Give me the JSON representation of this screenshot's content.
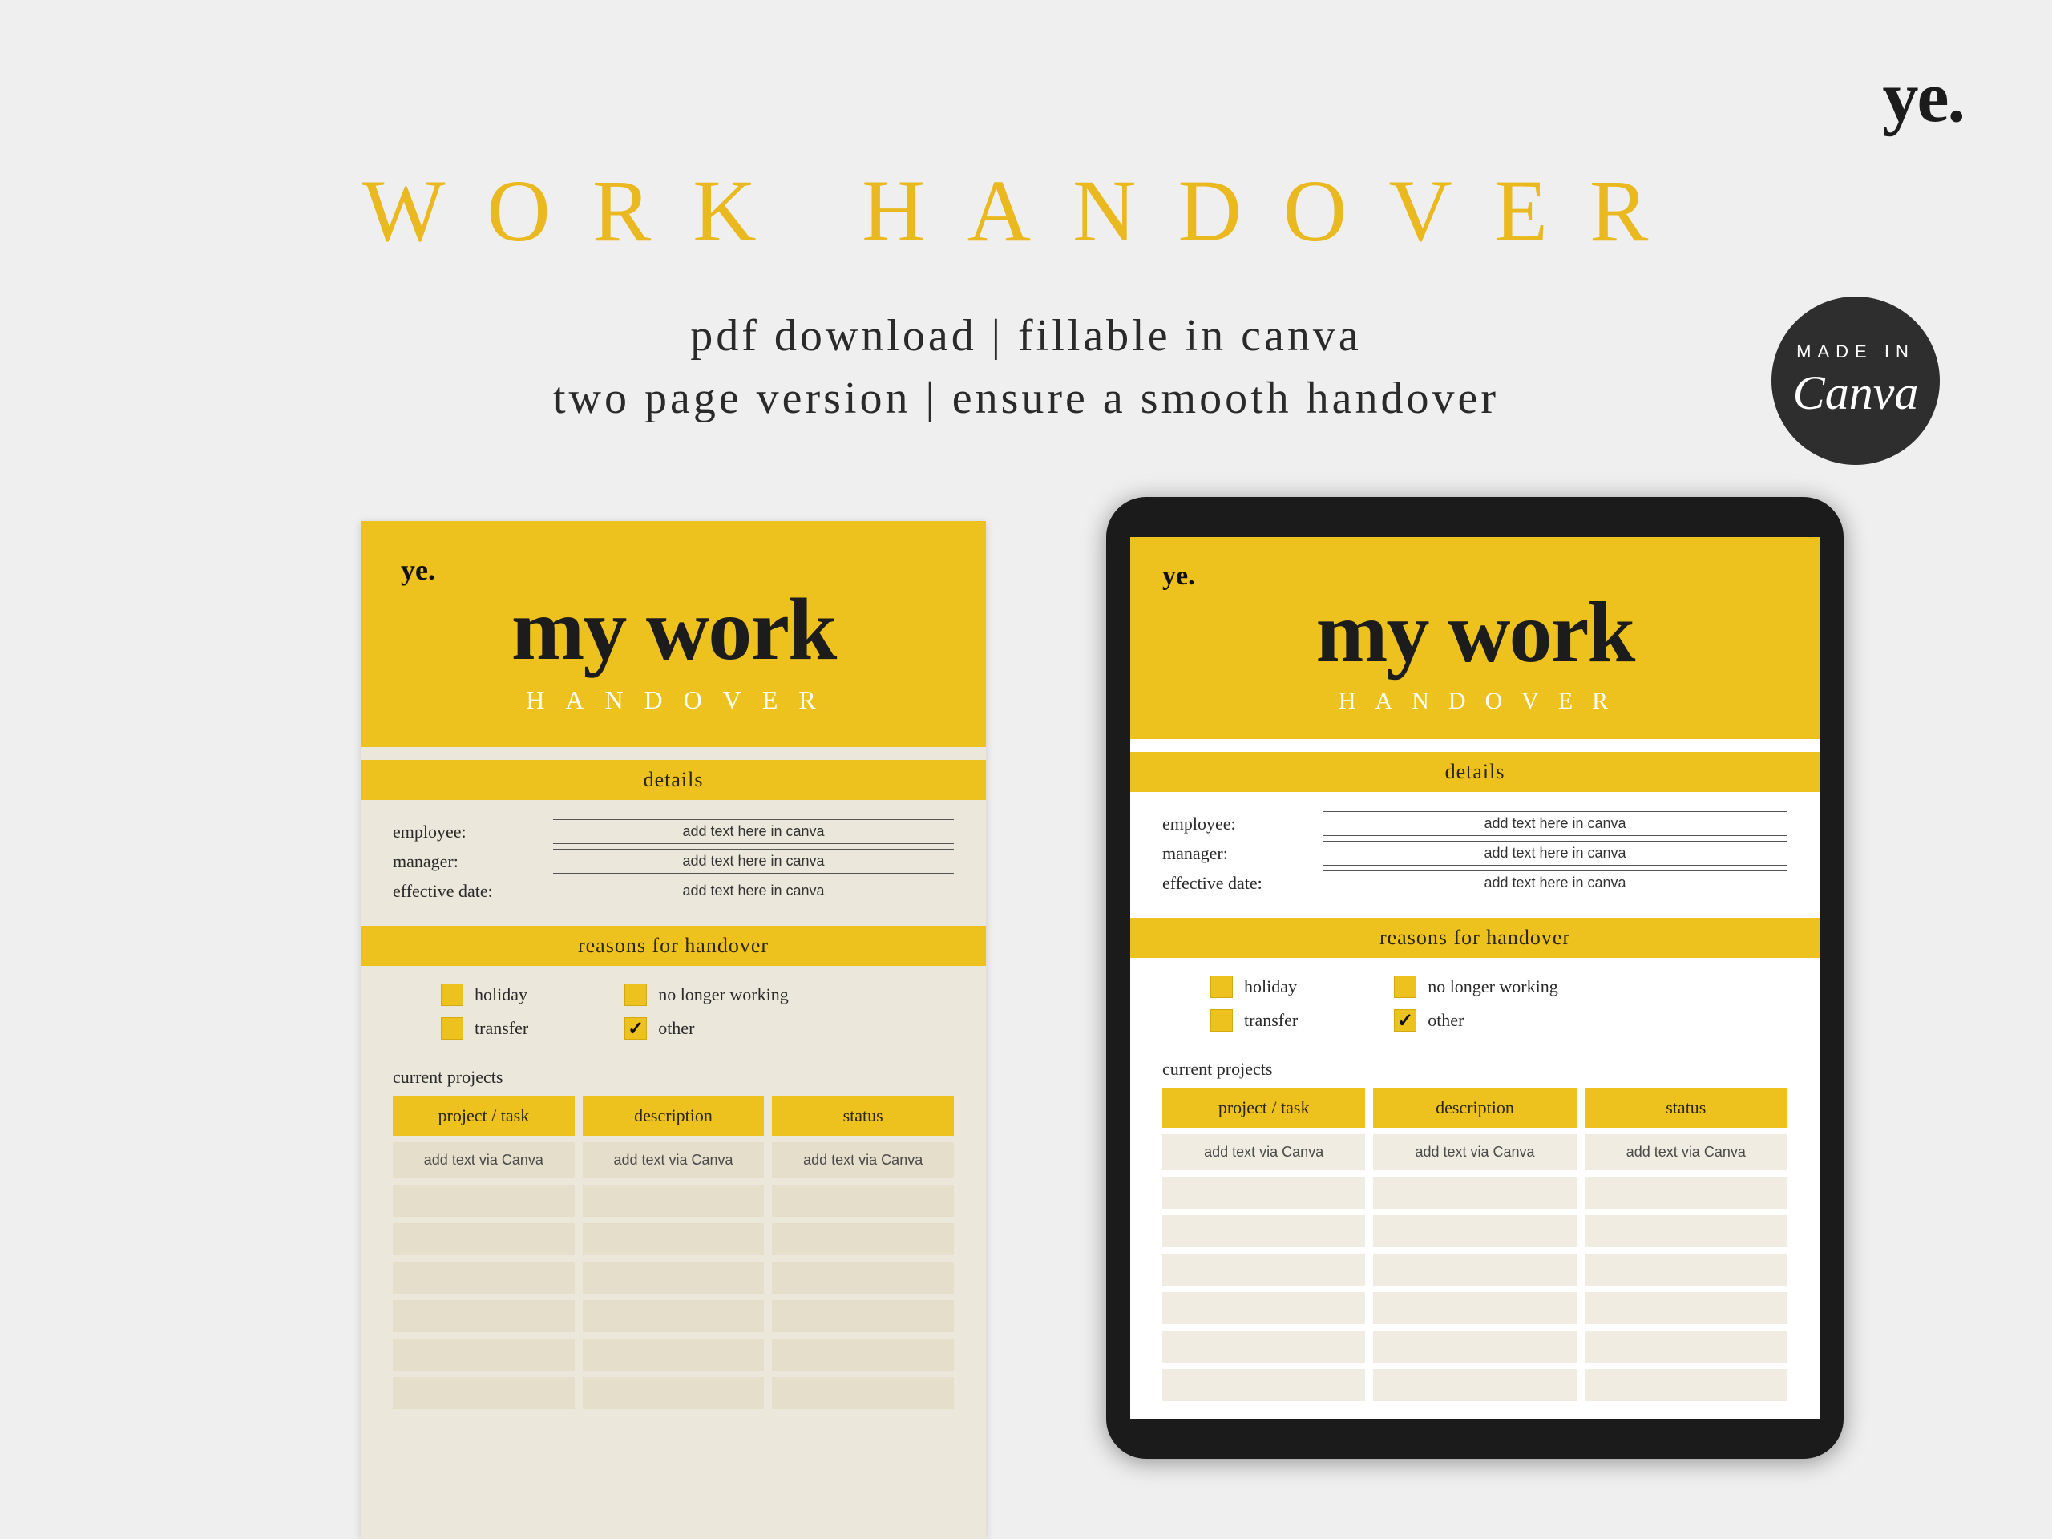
{
  "brand": "ye.",
  "headline": "WORK HANDOVER",
  "subhead_line1": "pdf download | fillable in canva",
  "subhead_line2": "two page version | ensure a smooth handover",
  "canva_badge": {
    "top": "MADE IN",
    "name": "Canva"
  },
  "form": {
    "brand_small": "ye.",
    "title_big": "my work",
    "title_sub": "HANDOVER",
    "band_details": "details",
    "band_reasons": "reasons for handover",
    "details": {
      "rows": [
        {
          "label": "employee:",
          "value": "add text here in canva"
        },
        {
          "label": "manager:",
          "value": "add text here in canva"
        },
        {
          "label": "effective date:",
          "value": "add text here in canva"
        }
      ]
    },
    "reasons": {
      "col1": [
        {
          "label": "holiday",
          "checked": false
        },
        {
          "label": "transfer",
          "checked": false
        }
      ],
      "col2": [
        {
          "label": "no longer working",
          "checked": false
        },
        {
          "label": "other",
          "checked": true
        }
      ]
    },
    "projects": {
      "label": "current projects",
      "headers": [
        "project / task",
        "description",
        "status"
      ],
      "hint": "add text via Canva",
      "blank_rows": 6
    }
  }
}
